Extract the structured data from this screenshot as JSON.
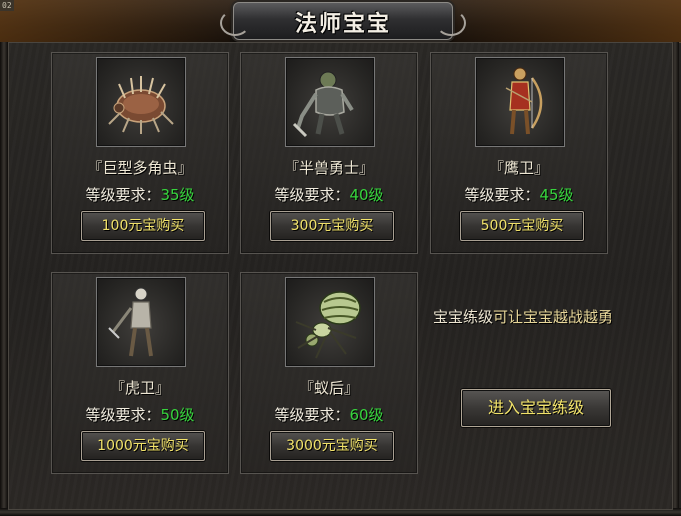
{
  "window": {
    "title": "法师宝宝",
    "corner_tag": "02"
  },
  "pets": [
    {
      "name": "『巨型多角虫』",
      "req_label": "等级要求：",
      "level": "35级",
      "buy_label": "100元宝购买",
      "icon": "giant-beetle-icon"
    },
    {
      "name": "『半兽勇士』",
      "req_label": "等级要求：",
      "level": "40级",
      "buy_label": "300元宝购买",
      "icon": "orc-warrior-icon"
    },
    {
      "name": "『鹰卫』",
      "req_label": "等级要求：",
      "level": "45级",
      "buy_label": "500元宝购买",
      "icon": "eagle-guard-archer-icon"
    },
    {
      "name": "『虎卫』",
      "req_label": "等级要求：",
      "level": "50级",
      "buy_label": "1000元宝购买",
      "icon": "tiger-guard-icon"
    },
    {
      "name": "『蚁后』",
      "req_label": "等级要求：",
      "level": "60级",
      "buy_label": "3000元宝购买",
      "icon": "ant-queen-icon"
    }
  ],
  "training": {
    "promo_part1": "宝宝练级",
    "promo_part2": "可让宝宝越战越勇",
    "button_label": "进入宝宝练级"
  },
  "colors": {
    "level_text": "#37d43d",
    "button_text": "#f1e26a"
  }
}
